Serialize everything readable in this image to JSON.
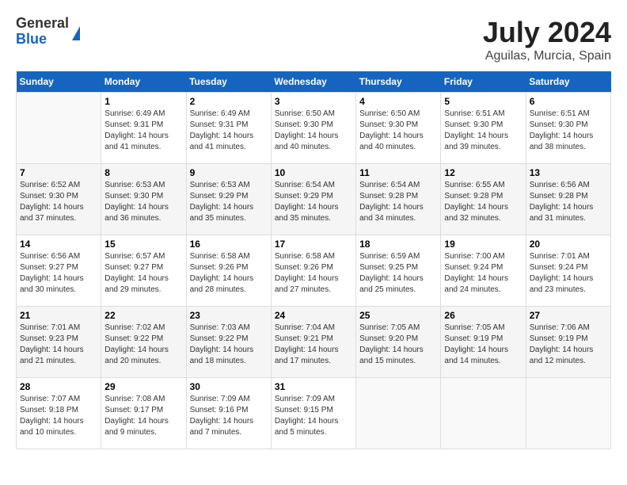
{
  "logo": {
    "general": "General",
    "blue": "Blue"
  },
  "title": "July 2024",
  "location": "Aguilas, Murcia, Spain",
  "days_of_week": [
    "Sunday",
    "Monday",
    "Tuesday",
    "Wednesday",
    "Thursday",
    "Friday",
    "Saturday"
  ],
  "weeks": [
    [
      {
        "num": "",
        "sunrise": "",
        "sunset": "",
        "daylight": ""
      },
      {
        "num": "1",
        "sunrise": "Sunrise: 6:49 AM",
        "sunset": "Sunset: 9:31 PM",
        "daylight": "Daylight: 14 hours and 41 minutes."
      },
      {
        "num": "2",
        "sunrise": "Sunrise: 6:49 AM",
        "sunset": "Sunset: 9:31 PM",
        "daylight": "Daylight: 14 hours and 41 minutes."
      },
      {
        "num": "3",
        "sunrise": "Sunrise: 6:50 AM",
        "sunset": "Sunset: 9:30 PM",
        "daylight": "Daylight: 14 hours and 40 minutes."
      },
      {
        "num": "4",
        "sunrise": "Sunrise: 6:50 AM",
        "sunset": "Sunset: 9:30 PM",
        "daylight": "Daylight: 14 hours and 40 minutes."
      },
      {
        "num": "5",
        "sunrise": "Sunrise: 6:51 AM",
        "sunset": "Sunset: 9:30 PM",
        "daylight": "Daylight: 14 hours and 39 minutes."
      },
      {
        "num": "6",
        "sunrise": "Sunrise: 6:51 AM",
        "sunset": "Sunset: 9:30 PM",
        "daylight": "Daylight: 14 hours and 38 minutes."
      }
    ],
    [
      {
        "num": "7",
        "sunrise": "Sunrise: 6:52 AM",
        "sunset": "Sunset: 9:30 PM",
        "daylight": "Daylight: 14 hours and 37 minutes."
      },
      {
        "num": "8",
        "sunrise": "Sunrise: 6:53 AM",
        "sunset": "Sunset: 9:30 PM",
        "daylight": "Daylight: 14 hours and 36 minutes."
      },
      {
        "num": "9",
        "sunrise": "Sunrise: 6:53 AM",
        "sunset": "Sunset: 9:29 PM",
        "daylight": "Daylight: 14 hours and 35 minutes."
      },
      {
        "num": "10",
        "sunrise": "Sunrise: 6:54 AM",
        "sunset": "Sunset: 9:29 PM",
        "daylight": "Daylight: 14 hours and 35 minutes."
      },
      {
        "num": "11",
        "sunrise": "Sunrise: 6:54 AM",
        "sunset": "Sunset: 9:28 PM",
        "daylight": "Daylight: 14 hours and 34 minutes."
      },
      {
        "num": "12",
        "sunrise": "Sunrise: 6:55 AM",
        "sunset": "Sunset: 9:28 PM",
        "daylight": "Daylight: 14 hours and 32 minutes."
      },
      {
        "num": "13",
        "sunrise": "Sunrise: 6:56 AM",
        "sunset": "Sunset: 9:28 PM",
        "daylight": "Daylight: 14 hours and 31 minutes."
      }
    ],
    [
      {
        "num": "14",
        "sunrise": "Sunrise: 6:56 AM",
        "sunset": "Sunset: 9:27 PM",
        "daylight": "Daylight: 14 hours and 30 minutes."
      },
      {
        "num": "15",
        "sunrise": "Sunrise: 6:57 AM",
        "sunset": "Sunset: 9:27 PM",
        "daylight": "Daylight: 14 hours and 29 minutes."
      },
      {
        "num": "16",
        "sunrise": "Sunrise: 6:58 AM",
        "sunset": "Sunset: 9:26 PM",
        "daylight": "Daylight: 14 hours and 28 minutes."
      },
      {
        "num": "17",
        "sunrise": "Sunrise: 6:58 AM",
        "sunset": "Sunset: 9:26 PM",
        "daylight": "Daylight: 14 hours and 27 minutes."
      },
      {
        "num": "18",
        "sunrise": "Sunrise: 6:59 AM",
        "sunset": "Sunset: 9:25 PM",
        "daylight": "Daylight: 14 hours and 25 minutes."
      },
      {
        "num": "19",
        "sunrise": "Sunrise: 7:00 AM",
        "sunset": "Sunset: 9:24 PM",
        "daylight": "Daylight: 14 hours and 24 minutes."
      },
      {
        "num": "20",
        "sunrise": "Sunrise: 7:01 AM",
        "sunset": "Sunset: 9:24 PM",
        "daylight": "Daylight: 14 hours and 23 minutes."
      }
    ],
    [
      {
        "num": "21",
        "sunrise": "Sunrise: 7:01 AM",
        "sunset": "Sunset: 9:23 PM",
        "daylight": "Daylight: 14 hours and 21 minutes."
      },
      {
        "num": "22",
        "sunrise": "Sunrise: 7:02 AM",
        "sunset": "Sunset: 9:22 PM",
        "daylight": "Daylight: 14 hours and 20 minutes."
      },
      {
        "num": "23",
        "sunrise": "Sunrise: 7:03 AM",
        "sunset": "Sunset: 9:22 PM",
        "daylight": "Daylight: 14 hours and 18 minutes."
      },
      {
        "num": "24",
        "sunrise": "Sunrise: 7:04 AM",
        "sunset": "Sunset: 9:21 PM",
        "daylight": "Daylight: 14 hours and 17 minutes."
      },
      {
        "num": "25",
        "sunrise": "Sunrise: 7:05 AM",
        "sunset": "Sunset: 9:20 PM",
        "daylight": "Daylight: 14 hours and 15 minutes."
      },
      {
        "num": "26",
        "sunrise": "Sunrise: 7:05 AM",
        "sunset": "Sunset: 9:19 PM",
        "daylight": "Daylight: 14 hours and 14 minutes."
      },
      {
        "num": "27",
        "sunrise": "Sunrise: 7:06 AM",
        "sunset": "Sunset: 9:19 PM",
        "daylight": "Daylight: 14 hours and 12 minutes."
      }
    ],
    [
      {
        "num": "28",
        "sunrise": "Sunrise: 7:07 AM",
        "sunset": "Sunset: 9:18 PM",
        "daylight": "Daylight: 14 hours and 10 minutes."
      },
      {
        "num": "29",
        "sunrise": "Sunrise: 7:08 AM",
        "sunset": "Sunset: 9:17 PM",
        "daylight": "Daylight: 14 hours and 9 minutes."
      },
      {
        "num": "30",
        "sunrise": "Sunrise: 7:09 AM",
        "sunset": "Sunset: 9:16 PM",
        "daylight": "Daylight: 14 hours and 7 minutes."
      },
      {
        "num": "31",
        "sunrise": "Sunrise: 7:09 AM",
        "sunset": "Sunset: 9:15 PM",
        "daylight": "Daylight: 14 hours and 5 minutes."
      },
      {
        "num": "",
        "sunrise": "",
        "sunset": "",
        "daylight": ""
      },
      {
        "num": "",
        "sunrise": "",
        "sunset": "",
        "daylight": ""
      },
      {
        "num": "",
        "sunrise": "",
        "sunset": "",
        "daylight": ""
      }
    ]
  ]
}
